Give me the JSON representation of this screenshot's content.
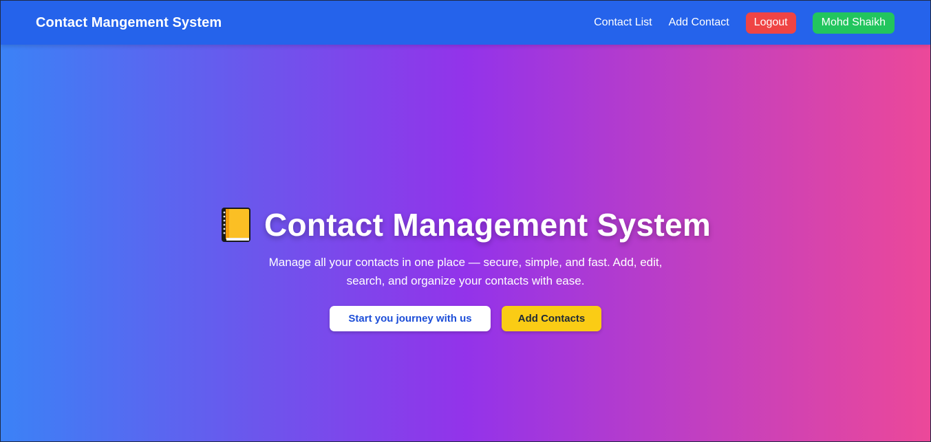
{
  "navbar": {
    "brand": "Contact Mangement System",
    "links": [
      "Contact List",
      "Add Contact"
    ],
    "logout_label": "Logout",
    "user_label": "Mohd Shaikh"
  },
  "hero": {
    "icon": "notebook-icon",
    "title": "Contact Management System",
    "subtitle": "Manage all your contacts in one place — secure, simple, and fast. Add, edit, search, and organize your contacts with ease.",
    "primary_button": "Start you journey with us",
    "secondary_button": "Add Contacts"
  },
  "colors": {
    "navbar_bg": "#2563eb",
    "logout_bg": "#ef4444",
    "user_bg": "#22c55e",
    "gradient_start": "#3b82f6",
    "gradient_mid": "#9333ea",
    "gradient_end": "#ec4899",
    "add_button_bg": "#facc15"
  }
}
